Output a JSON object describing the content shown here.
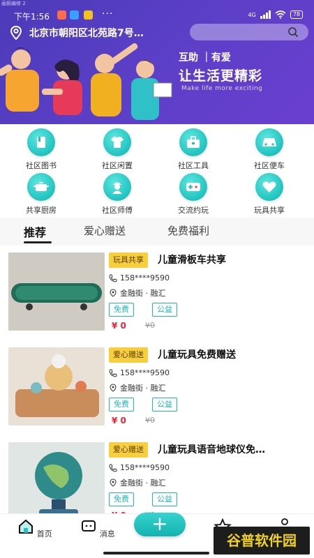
{
  "banner": {
    "caption": "画板编修 2",
    "status": {
      "time": "下午1:56",
      "dots": "···",
      "network": "4G",
      "battery": "78"
    },
    "location": "北京市朝阳区北苑路7号…",
    "search_placeholder": "",
    "slogan_line1": "互助 ｜有爱",
    "slogan_line2": "让生活更精彩",
    "slogan_line3": "Make life more exciting"
  },
  "categories": [
    {
      "label": "社区图书",
      "icon": "book-icon"
    },
    {
      "label": "社区闲置",
      "icon": "shirt-icon"
    },
    {
      "label": "社区工具",
      "icon": "toolbox-icon"
    },
    {
      "label": "社区便车",
      "icon": "car-icon"
    },
    {
      "label": "共享厨房",
      "icon": "pot-icon"
    },
    {
      "label": "社区师傅",
      "icon": "worker-icon"
    },
    {
      "label": "交流约玩",
      "icon": "gamepad-icon"
    },
    {
      "label": "玩具共享",
      "icon": "heart-icon"
    }
  ],
  "tabs": [
    {
      "label": "推荐",
      "active": true
    },
    {
      "label": "爱心赠送",
      "active": false
    },
    {
      "label": "免费福利",
      "active": false
    }
  ],
  "items": [
    {
      "tag": "玩具共享",
      "title": "儿童滑板车共享",
      "phone": "158****9590",
      "address": "金融街 · 融汇",
      "chips": [
        "免费",
        "公益"
      ],
      "price": "¥ 0",
      "orig_price": "¥0"
    },
    {
      "tag": "爱心赠送",
      "title": "儿童玩具免费赠送",
      "phone": "158****9590",
      "address": "金融街 · 融汇",
      "chips": [
        "免费",
        "公益"
      ],
      "price": "¥ 0",
      "orig_price": "¥0"
    },
    {
      "tag": "爱心赠送",
      "title": "儿童玩具语音地球仪免…",
      "phone": "158****9590",
      "address": "金融街 · 融汇",
      "chips": [
        "免费",
        "公益"
      ],
      "price": "¥ 0",
      "orig_price": "¥0"
    }
  ],
  "bottom_nav": {
    "home_label": "首页",
    "message_label": "消息",
    "plus_label": "+",
    "watermark": "谷普软件园"
  },
  "colors": {
    "accent": "#20c3c0",
    "price": "#e8253a",
    "tag": "#f7cf3c",
    "banner": "#5a3fc6"
  }
}
